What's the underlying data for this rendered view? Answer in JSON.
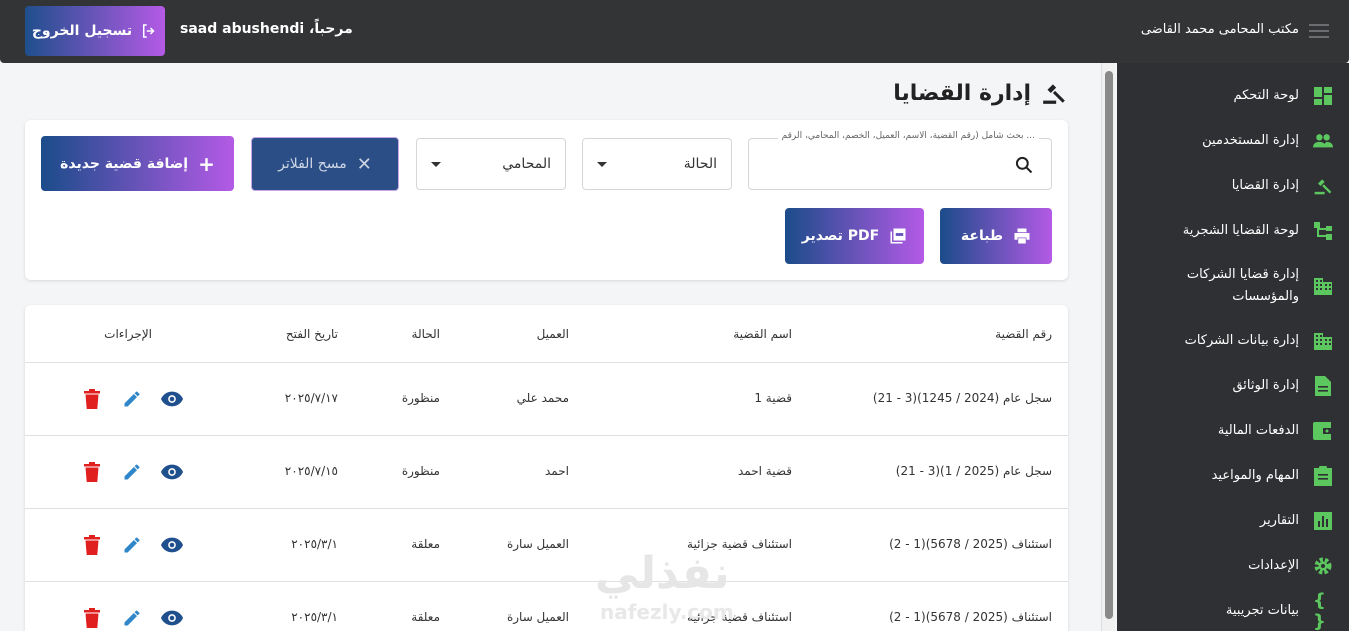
{
  "header": {
    "office_title": "مكتب المحامى محمد القاضى",
    "welcome": "مرحباً، saad abushendi",
    "logout_label": "تسجيل الخروج"
  },
  "sidebar": {
    "items": [
      {
        "label": "لوحة التحكم",
        "icon": "dashboard-icon"
      },
      {
        "label": "إدارة المستخدمين",
        "icon": "users-icon"
      },
      {
        "label": "إدارة القضايا",
        "icon": "gavel-icon"
      },
      {
        "label": "لوحة القضايا الشجرية",
        "icon": "tree-icon"
      },
      {
        "label_line1": "إدارة قضايا الشركات",
        "label_line2": "والمؤسسات",
        "icon": "building-icon"
      },
      {
        "label": "إدارة بيانات الشركات",
        "icon": "building-icon"
      },
      {
        "label": "إدارة الوثائق",
        "icon": "document-icon"
      },
      {
        "label": "الدفعات المالية",
        "icon": "wallet-icon"
      },
      {
        "label": "المهام والمواعيد",
        "icon": "clipboard-icon"
      },
      {
        "label": "التقارير",
        "icon": "chart-icon"
      },
      {
        "label": "الإعدادات",
        "icon": "gear-icon"
      },
      {
        "label": "بيانات تجريبية",
        "icon": "braces-icon"
      }
    ]
  },
  "page": {
    "title": "إدارة القضايا"
  },
  "filters": {
    "search_label": "بحث شامل (رقم القضية، الاسم، العميل، الخصم، المحامي، الرقم ...",
    "status_label": "الحالة",
    "lawyer_label": "المحامي",
    "clear_label": "مسح الفلاتر",
    "add_label": "إضافة قضية جديدة",
    "print_label": "طباعة",
    "pdf_label": "تصدير PDF"
  },
  "table": {
    "headers": {
      "case_number": "رقم القضية",
      "case_name": "اسم القضية",
      "client": "العميل",
      "status": "الحالة",
      "open_date": "تاريخ الفتح",
      "actions": "الإجراءات"
    },
    "rows": [
      {
        "case_number": "(21 - 3)(1245 / 2024) سجل عام",
        "case_name": "قضية 1",
        "client": "محمد علي",
        "status": "منظورة",
        "open_date": "٢٠٢٥/٧/١٧"
      },
      {
        "case_number": "(21 - 3)(1 / 2025) سجل عام",
        "case_name": "قضية احمد",
        "client": "احمد",
        "status": "منظورة",
        "open_date": "٢٠٢٥/٧/١٥"
      },
      {
        "case_number": "(2 - 1)(5678 / 2025) استئناف",
        "case_name": "استئناف قضية جزائية",
        "client": "العميل سارة",
        "status": "معلقة",
        "open_date": "٢٠٢٥/٣/١"
      },
      {
        "case_number": "(2 - 1)(5678 / 2025) استئناف",
        "case_name": "استئناف قضية جزائية",
        "client": "العميل سارة",
        "status": "معلقة",
        "open_date": "٢٠٢٥/٣/١"
      }
    ]
  },
  "watermark": {
    "main": "نفذلي",
    "sub": "nafezly.com"
  },
  "colors": {
    "icon_green": "#5cc75f",
    "view_blue": "#1f4f8c",
    "edit_blue": "#2f86c9",
    "delete_red": "#e01f1f"
  }
}
